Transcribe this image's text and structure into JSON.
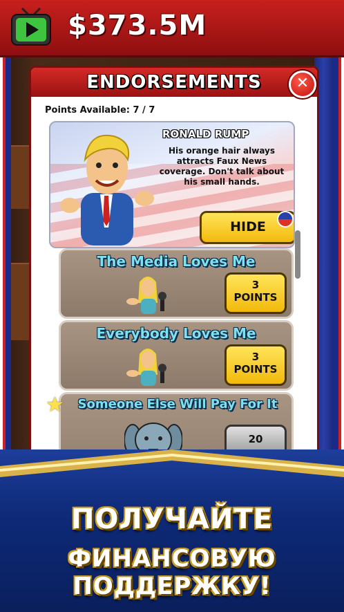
{
  "topbar": {
    "money": "$373.5M",
    "tv_icon": "tv-play-icon"
  },
  "panel": {
    "title": "ENDORSEMENTS",
    "close_icon": "close-icon",
    "points_available": "Points Available: 7 / 7"
  },
  "candidate": {
    "name": "RONALD RUMP",
    "description": "His orange hair always attracts Faux News coverage. Don't talk about his small hands.",
    "hide_label": "HIDE",
    "party_icon": "party-icon"
  },
  "endorsements": [
    {
      "title": "The Media Loves Me",
      "points": "3",
      "points_label": "POINTS",
      "icon": "reporter-icon"
    },
    {
      "title": "Everybody Loves Me",
      "points": "3",
      "points_label": "POINTS",
      "icon": "reporter-icon"
    },
    {
      "title": "Someone Else Will Pay For It",
      "points": "20",
      "icon": "elephant-icon",
      "badge": "star-icon"
    }
  ],
  "promo": {
    "line1": "ПОЛУЧАЙТЕ",
    "line2": "ФИНАНСОВУЮ ПОДДЕРЖКУ!"
  },
  "colors": {
    "topbar": "#c8201d",
    "button": "#f2b90c",
    "banner": "#0e2a78",
    "card": "#8c7a6a"
  }
}
